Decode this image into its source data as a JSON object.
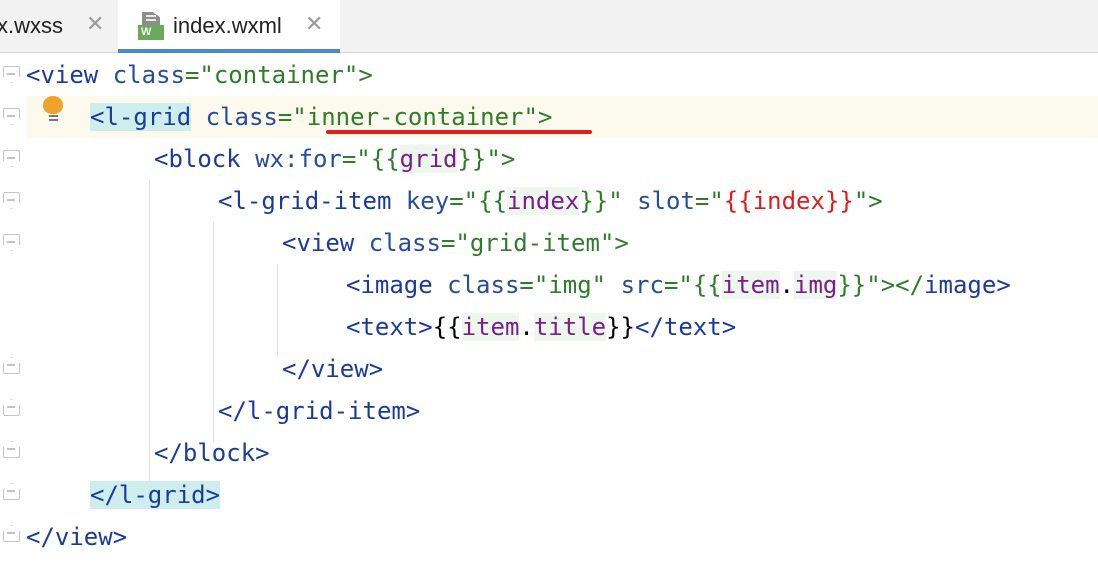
{
  "tabs": [
    {
      "label": "x.wxss",
      "active": false
    },
    {
      "label": "index.wxml",
      "active": true,
      "badge": "W"
    }
  ],
  "code": {
    "line1": {
      "open": "<",
      "tag": "view",
      "attr": "class",
      "eq": "=\"",
      "val": "container",
      "close": "\">"
    },
    "line2": {
      "open": "<",
      "tag": "l-grid",
      "attr": "class",
      "eq": "=\"",
      "val": "inner-container",
      "close": "\">"
    },
    "line3": {
      "open": "<",
      "tag": "block",
      "attr": "wx:for",
      "eq": "=\"",
      "b1": "{{",
      "var": "grid",
      "b2": "}}",
      "close": "\">"
    },
    "line4": {
      "open": "<",
      "tag": "l-grid-item",
      "attr1": "key",
      "eq1": "=\"",
      "b1": "{{",
      "var1": "index",
      "b2": "}}",
      "q1": "\"",
      "attr2": "slot",
      "eq2": "=\"",
      "slotval": "{{index}}",
      "close": "\">"
    },
    "line5": {
      "open": "<",
      "tag": "view",
      "attr": "class",
      "eq": "=\"",
      "val": "grid-item",
      "close": "\">"
    },
    "line6": {
      "open": "<",
      "tag": "image",
      "attr1": "class",
      "eq1": "=\"",
      "val1": "img",
      "q1": "\"",
      "attr2": "src",
      "eq2": "=\"",
      "b1": "{{",
      "var": "item",
      "dot": ".",
      "prop": "img",
      "b2": "}}",
      "close": "\"></",
      "endtag": "image",
      "gt": ">"
    },
    "line7": {
      "open": "<",
      "tag": "text",
      "gt": ">",
      "b1": "{{",
      "var": "item",
      "dot": ".",
      "prop": "title",
      "b2": "}}",
      "closeopen": "</",
      "endtag": "text",
      "gt2": ">"
    },
    "line8": {
      "open": "</",
      "tag": "view",
      "gt": ">"
    },
    "line9": {
      "open": "</",
      "tag": "l-grid-item",
      "gt": ">"
    },
    "line10": {
      "open": "</",
      "tag": "block",
      "gt": ">"
    },
    "line11": {
      "open": "</",
      "tag": "l-grid",
      "gt": ">"
    },
    "line12": {
      "open": "</",
      "tag": "view",
      "gt": ">"
    }
  },
  "colors": {
    "tag": "#1b3b9c",
    "string": "#2f7d2a",
    "variable": "#7b1d8e",
    "slot_value": "#e01b1b",
    "underline": "#e02020",
    "active_tab_border": "#4a88c7",
    "current_line": "#fcfaed"
  },
  "icons": [
    "close-icon",
    "wxml-file-icon",
    "lightbulb-icon",
    "fold-open-icon",
    "fold-close-icon"
  ]
}
